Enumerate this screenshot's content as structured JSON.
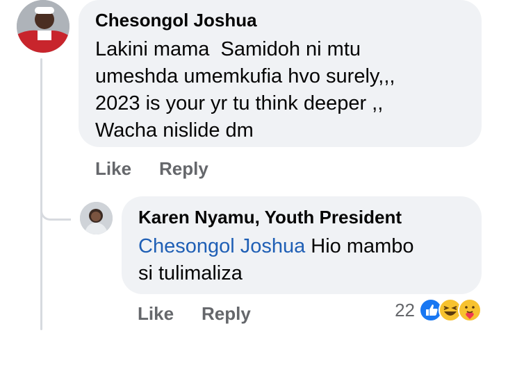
{
  "comments": [
    {
      "author": "Chesongol Joshua",
      "text": "Lakini mama  Samidoh ni mtu\numeshda umemkufia hvo surely,,,\n2023 is your yr tu think deeper ,,\nWacha nislide dm",
      "actions": {
        "like": "Like",
        "reply": "Reply"
      }
    }
  ],
  "reply": {
    "author": "Karen Nyamu, Youth President",
    "mention": "Chesongol Joshua",
    "text": " Hio mambo\nsi tulimaliza",
    "actions": {
      "like": "Like",
      "reply": "Reply"
    },
    "reaction_count": "22",
    "reactions": [
      "like-icon",
      "laugh-icon",
      "care-icon"
    ]
  },
  "colors": {
    "bubble": "#f0f2f5",
    "mention": "#1f5fb5",
    "action_text": "#65676b",
    "like_blue": "#1877f2",
    "emoji_yellow": "#f7c22f"
  }
}
